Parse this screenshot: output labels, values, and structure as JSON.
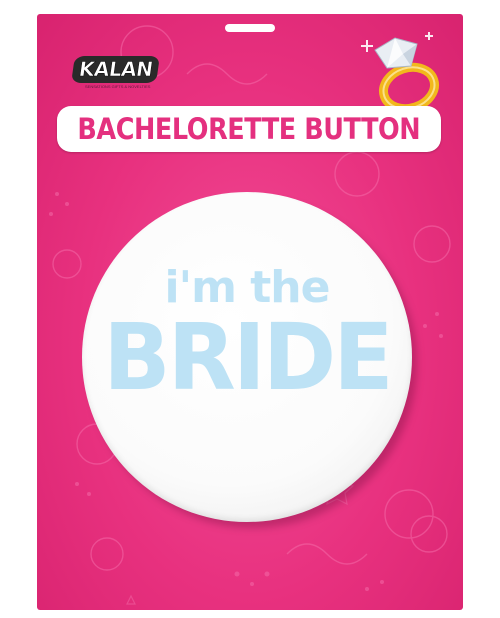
{
  "brand": {
    "name": "KALAN",
    "tagline": "SENSATIONS GIFTS & NOVELTIES"
  },
  "header": {
    "title": "BACHELORETTE BUTTON"
  },
  "badge": {
    "line1": "i'm the",
    "line2": "BRIDE"
  },
  "colors": {
    "card_pink": "#e8317f",
    "title_pink": "#e4307f",
    "badge_text_blue": "#bde2f5",
    "ring_gold": "#f2b81c",
    "logo_dark": "#2a2a2a"
  },
  "icons": {
    "ring": "diamond-ring-icon"
  }
}
